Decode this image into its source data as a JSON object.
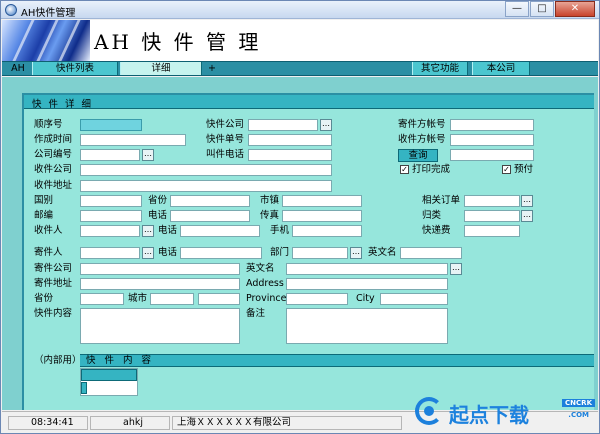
{
  "window": {
    "title": "AH快件管理"
  },
  "window_controls": {
    "minimize": "—",
    "maximize": "□",
    "close": "✕"
  },
  "banner": {
    "brand": "AH 快 件 管 理"
  },
  "tabs": {
    "ah": "AH",
    "list": "快件列表",
    "detail": "详细",
    "plus": "+",
    "other": "其它功能",
    "company": "本公司"
  },
  "panel": {
    "title": "快 件 详 细"
  },
  "form": {
    "seq": "顺序号",
    "created": "作成时间",
    "company_no": "公司编号",
    "recv_company": "收件公司",
    "recv_address": "收件地址",
    "express_company": "快件公司",
    "express_no": "快件单号",
    "call_phone": "叫件电话",
    "sender_account": "寄件方帐号",
    "receiver_account": "收件方帐号",
    "query_btn": "查询",
    "print_done": "打印完成",
    "prepaid": "预付",
    "country": "国别",
    "province": "省份",
    "city_town": "市镇",
    "related_order": "相关订单",
    "zip": "邮编",
    "phone": "电话",
    "fax": "传真",
    "category": "归类",
    "receiver": "收件人",
    "phone2": "电话",
    "mobile": "手机",
    "fee": "快递费",
    "sender": "寄件人",
    "phone3": "电话",
    "dept": "部门",
    "en_name": "英文名",
    "sender_company": "寄件公司",
    "en_name2": "英文名",
    "sender_address": "寄件地址",
    "address_en": "Address",
    "province2": "省份",
    "city2": "城市",
    "province_en": "Province",
    "city_en": "City",
    "content": "快件内容",
    "remarks": "备注",
    "internal": "（内部用）",
    "content_table": "快 件 内 容"
  },
  "status": {
    "time": "08:34:41",
    "user": "ahkj",
    "company": "上海ＸＸＸＸＸＸ有限公司"
  },
  "watermark": {
    "text": "起点下载",
    "tag": "CNCRK",
    "tag2": ".COM"
  },
  "colors": {
    "panel": "#96e6dc",
    "accent": "#35b4c2",
    "tabbar": "#2b8fa4"
  },
  "icons": {
    "app": "app-icon",
    "ellipsis": "ellipsis-icon",
    "check": "check-icon"
  }
}
